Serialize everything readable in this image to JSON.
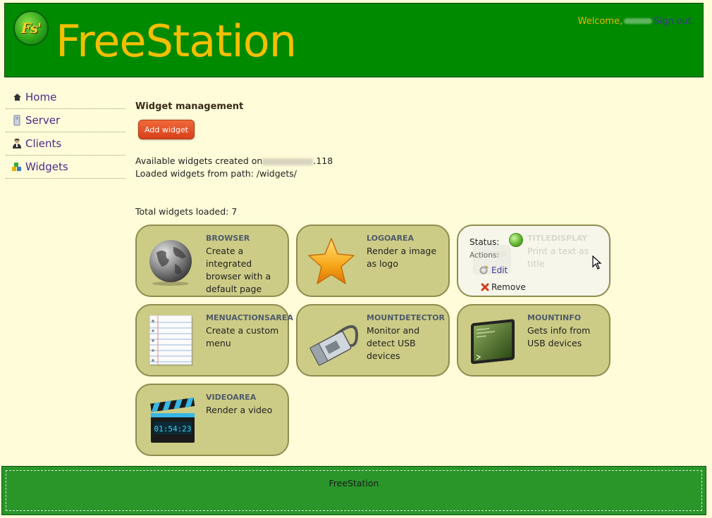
{
  "header": {
    "logo_text": "Fs'",
    "title": "FreeStation",
    "welcome_label": "Welcome,",
    "signout_label": "Sign out"
  },
  "nav": {
    "items": [
      {
        "label": "Home",
        "icon": "home-icon"
      },
      {
        "label": "Server",
        "icon": "server-icon"
      },
      {
        "label": "Clients",
        "icon": "clients-icon"
      },
      {
        "label": "Widgets",
        "icon": "widgets-icon"
      }
    ]
  },
  "main": {
    "section_title": "Widget management",
    "add_button_label": "Add widget",
    "created_on_prefix": "Available widgets created on",
    "created_on_suffix": ".118",
    "path_line": "Loaded widgets from path: /widgets/",
    "total_line": "Total widgets loaded: 7"
  },
  "widgets": [
    {
      "title": "BROWSER",
      "desc": "Create a integrated browser with a default page",
      "icon": "globe-icon"
    },
    {
      "title": "LOGOAREA",
      "desc": "Render a image as logo",
      "icon": "star-icon"
    },
    {
      "title": "TITLEDISPLAY",
      "desc": "Print a text as title",
      "icon": "title-icon"
    },
    {
      "title": "MENUACTIONSAREA",
      "desc": "Create a custom menu",
      "icon": "notepad-icon"
    },
    {
      "title": "MOUNTDETECTOR",
      "desc": "Monitor and detect USB devices",
      "icon": "usb-icon"
    },
    {
      "title": "MOUNTINFO",
      "desc": "Gets info from USB devices",
      "icon": "terminal-icon"
    },
    {
      "title": "VIDEOAREA",
      "desc": "Render a video",
      "icon": "clapperboard-icon",
      "clock_text": "01:54:23"
    }
  ],
  "hover_overlay": {
    "status_label": "Status:",
    "actions_label": "Actions:",
    "edit_label": "Edit",
    "remove_label": "Remove",
    "status_color": "#5cb02a"
  },
  "footer": {
    "text": "FreeStation"
  },
  "colors": {
    "header_bg": "#008a00",
    "title_color": "#f3bf00",
    "page_bg": "#fffcd9",
    "card_bg": "#cccc86",
    "button_bg": "#e04f25",
    "footer_bg": "#2a962a"
  }
}
